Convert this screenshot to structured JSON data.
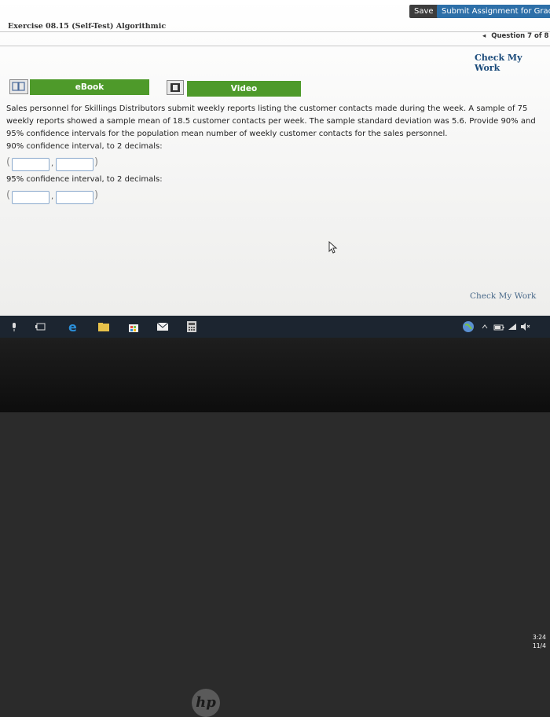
{
  "toolbar": {
    "save_label": "Save",
    "submit_label": "Submit Assignment for Grading"
  },
  "exercise": {
    "title": "Exercise 08.15 (Self-Test) Algorithmic",
    "question_nav": "Question 7 of 8",
    "check_my_work": "Check My Work"
  },
  "media": {
    "ebook_label": "eBook",
    "video_label": "Video"
  },
  "problem": {
    "text": "Sales personnel for Skillings Distributors submit weekly reports listing the customer contacts made during the week. A sample of 75 weekly reports showed a sample mean of 18.5 customer contacts per week. The sample standard deviation was 5.6. Provide 90% and 95% confidence intervals for the population mean number of weekly customer contacts for the sales personnel."
  },
  "ci90": {
    "label": "90% confidence interval, to 2 decimals:",
    "open_paren": "(",
    "separator": ",",
    "close_paren": ")",
    "lower_value": "",
    "upper_value": ""
  },
  "ci95": {
    "label": "95% confidence interval, to 2 decimals:",
    "open_paren": "(",
    "separator": ",",
    "close_paren": ")",
    "lower_value": "",
    "upper_value": ""
  },
  "footer": {
    "check_my_work": "Check My Work"
  },
  "taskbar": {
    "time": "3:24",
    "date": "11/4"
  },
  "laptop": {
    "logo": "hp"
  },
  "colors": {
    "accent_green": "#4e9a2a",
    "submit_blue": "#2d6fa8",
    "field_border": "#8aa9cc"
  }
}
